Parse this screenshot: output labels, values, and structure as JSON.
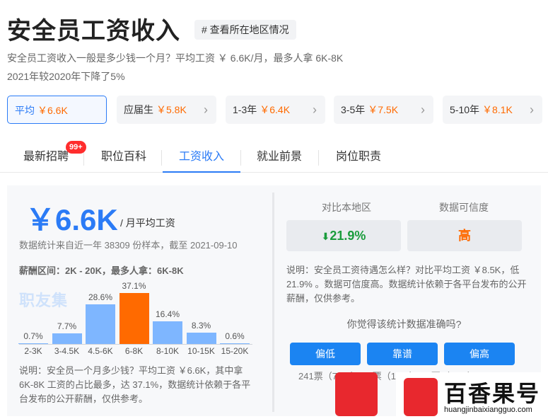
{
  "header": {
    "title": "安全员工资收入",
    "region_link": "# 查看所在地区情况"
  },
  "summary": {
    "line1": "安全员工资收入一般是多少钱一个月？平均工资 ￥ 6.6K/月，最多人拿 6K-8K",
    "line2": "2021年较2020年下降了5%"
  },
  "experience": [
    {
      "label": "平均",
      "value": "￥6.6K"
    },
    {
      "label": "应届生",
      "value": "￥5.8K"
    },
    {
      "label": "1-3年",
      "value": "￥6.4K"
    },
    {
      "label": "3-5年",
      "value": "￥7.5K"
    },
    {
      "label": "5-10年",
      "value": "￥8.1K"
    }
  ],
  "tabs": [
    "最新招聘",
    "职位百科",
    "工资收入",
    "就业前景",
    "岗位职责"
  ],
  "badge": "99+",
  "salary": {
    "big": "￥6.6K",
    "unit": "/ 月平均工资",
    "source": "数据统计来自近一年 38309 份样本，截至 2021-09-10",
    "range": "薪酬区间：2K - 20K，最多人拿：6K-8K",
    "watermark": "职友集",
    "description": "说明：安全员一个月多少钱？平均工资 ￥6.6K，其中拿 6K-8K 工资的占比最多，达 37.1%，数据统计依赖于各平台发布的公开薪酬，仅供参考。"
  },
  "chart_data": {
    "type": "bar",
    "categories": [
      "2-3K",
      "3-4.5K",
      "4.5-6K",
      "6-8K",
      "8-10K",
      "10-15K",
      "15-20K"
    ],
    "values": [
      0.7,
      7.7,
      28.6,
      37.1,
      16.4,
      8.3,
      0.6
    ],
    "labels": [
      "0.7%",
      "7.7%",
      "28.6%",
      "37.1%",
      "16.4%",
      "8.3%",
      "0.6%"
    ],
    "highlight_index": 3,
    "colors": {
      "bar": "#7eb6ff",
      "highlight": "#ff6a00"
    }
  },
  "compare": {
    "col1": "对比本地区",
    "col2": "数据可信度",
    "delta": "21.9%",
    "reliability": "高",
    "text": "说明：安全员工资待遇怎么样？对比平均工资 ￥8.5K，低 21.9% 。数据可信度高。数据统计依赖于各平台发布的公开薪酬，仅供参考。"
  },
  "feedback": {
    "question": "你觉得该统计数据准确吗?",
    "buttons": [
      "偏低",
      "靠谱",
      "偏高"
    ],
    "votes": "241票（73%）   52票（16%）   38票（11%）"
  },
  "brand": {
    "name": "百香果号",
    "domain": "huangjinbaixiangguo.com"
  }
}
